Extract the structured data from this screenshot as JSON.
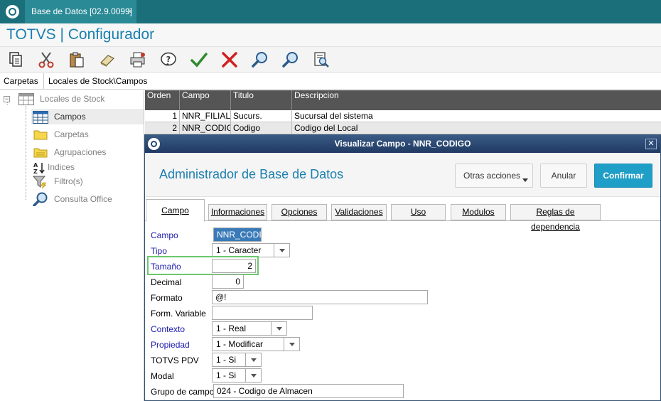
{
  "window_tab": {
    "title": "Base de Datos [02.9.0099]",
    "close": "×"
  },
  "app": {
    "title": "TOTVS | Configurador"
  },
  "toolbar": {
    "icons": [
      "copy-icon",
      "cut-icon",
      "paste-icon",
      "eraser-icon",
      "print-icon",
      "help-icon",
      "confirm-check-icon",
      "cancel-x-icon",
      "search-icon",
      "search-next-icon",
      "preview-icon"
    ]
  },
  "pathbar": {
    "label": "Carpetas",
    "path": "Locales de Stock\\Campos"
  },
  "tree": {
    "root": "Locales de Stock",
    "items": [
      {
        "label": "Campos",
        "selected": true
      },
      {
        "label": "Carpetas"
      },
      {
        "label": "Agrupaciones"
      },
      {
        "label": "Indices"
      },
      {
        "label": "Filtro(s)"
      },
      {
        "label": "Consulta Office"
      }
    ]
  },
  "grid": {
    "headers": [
      "Orden",
      "Campo",
      "Titulo",
      "Descripcion"
    ],
    "rows": [
      [
        "1",
        "NNR_FILIAL",
        "Sucurs.",
        "Sucursal del sistema"
      ],
      [
        "2",
        "NNR_CODIGO",
        "Codigo",
        "Codigo del Local"
      ]
    ]
  },
  "dialog": {
    "title": "Visualizar Campo - NNR_CODIGO",
    "close": "✕",
    "heading": "Administrador de Base de Datos",
    "buttons": {
      "otras": "Otras acciones",
      "anular": "Anular",
      "confirmar": "Confirmar"
    },
    "tabs": [
      "Campo",
      "Informaciones",
      "Opciones",
      "Validaciones",
      "Uso",
      "Modulos",
      "Reglas de dependencia"
    ],
    "form": {
      "campo_label": "Campo",
      "campo_value": "NNR_CODIGO",
      "tipo_label": "Tipo",
      "tipo_value": "1 - Caracter",
      "tamano_label": "Tamaño",
      "tamano_value": "2",
      "decimal_label": "Decimal",
      "decimal_value": "0",
      "formato_label": "Formato",
      "formato_value": "@!",
      "formvar_label": "Form. Variable",
      "formvar_value": "",
      "contexto_label": "Contexto",
      "contexto_value": "1 - Real",
      "propiedad_label": "Propiedad",
      "propiedad_value": "1 - Modificar",
      "totvspdv_label": "TOTVS PDV",
      "totvspdv_value": "1 - Si",
      "modal_label": "Modal",
      "modal_value": "1 - Si",
      "grupo_label": "Grupo de campos",
      "grupo_value": "024 - Codigo de Almacen"
    }
  },
  "colors": {
    "brand_teal": "#1b6f7a",
    "title_blue": "#1a7fb0",
    "confirm_blue": "#1f9ec7",
    "highlight_green": "#6cc86c"
  }
}
